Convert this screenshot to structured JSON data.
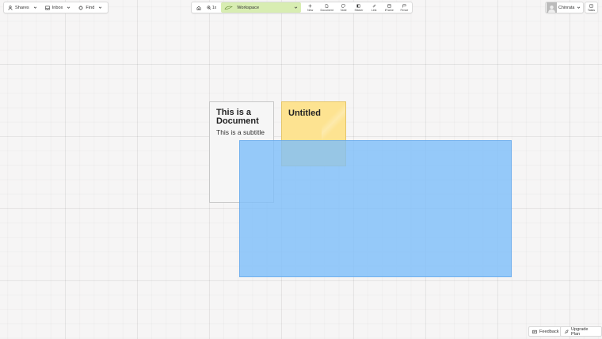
{
  "top_left": {
    "shares_label": "Shares",
    "inbox_label": "Inbox",
    "find_label": "Find"
  },
  "toolbar": {
    "zoom_label": "1x",
    "workspace_label": "Workspace",
    "tools": [
      {
        "label": "New",
        "icon": "plus-icon"
      },
      {
        "label": "Document",
        "icon": "document-icon"
      },
      {
        "label": "Note",
        "icon": "note-icon"
      },
      {
        "label": "Sticker",
        "icon": "sticker-icon"
      },
      {
        "label": "Link",
        "icon": "link-icon"
      },
      {
        "label": "iFrame",
        "icon": "iframe-icon"
      },
      {
        "label": "Fence",
        "icon": "fence-icon"
      }
    ]
  },
  "account": {
    "user_name": "Chinrata",
    "tasks_label": "Tasks"
  },
  "canvas": {
    "document": {
      "title": "This is a Document",
      "subtitle": "This is a subtitle"
    },
    "sticky": {
      "title": "Untitled"
    }
  },
  "bottom": {
    "feedback_label": "Feedback",
    "upgrade_label": "Upgrade Plan"
  },
  "colors": {
    "workspace_bg": "#d8edb2",
    "sticky_bg": "#fde391",
    "rect_fill": "#7dbefa"
  }
}
